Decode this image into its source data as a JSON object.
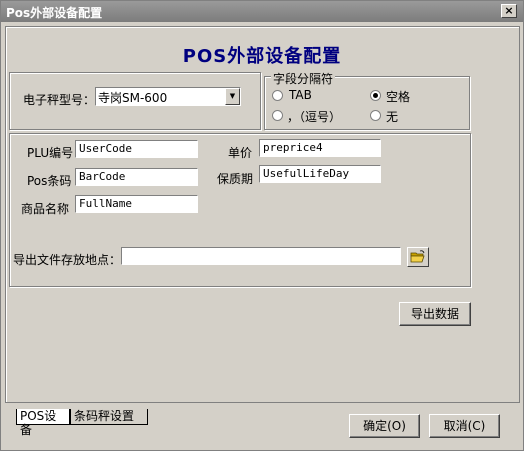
{
  "window": {
    "title": "Pos外部设备配置",
    "close_label": "×"
  },
  "heading": "POS外部设备配置",
  "scale": {
    "label": "电子秤型号：",
    "selected": "寺岗SM-600"
  },
  "separator": {
    "legend": "字段分隔符",
    "options": [
      {
        "label": "TAB",
        "checked": false
      },
      {
        "label": "空格",
        "checked": true
      },
      {
        "label": "，（逗号）",
        "checked": false
      },
      {
        "label": "无",
        "checked": false
      }
    ]
  },
  "fields": {
    "plu_label": "PLU编号",
    "plu_value": "UserCode",
    "price_label": "单价",
    "price_value": "preprice4",
    "barcode_label": "Pos条码",
    "barcode_value": "BarCode",
    "shelf_label": "保质期",
    "shelf_value": "UsefulLifeDay",
    "name_label": "商品名称",
    "name_value": "FullName"
  },
  "export": {
    "path_label": "导出文件存放地点：",
    "path_value": "",
    "button": "导出数据"
  },
  "tabs": [
    {
      "label": "POS设备"
    },
    {
      "label": "条码秤设置"
    }
  ],
  "footer": {
    "ok": "确定(O)",
    "cancel": "取消(C)"
  }
}
